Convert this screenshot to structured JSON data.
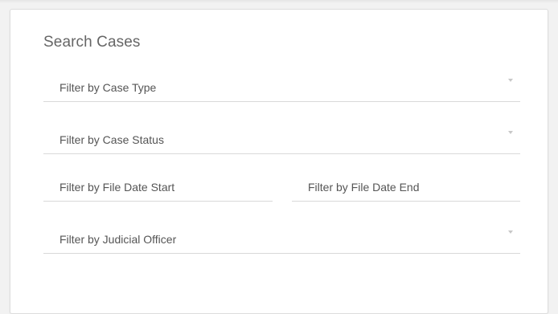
{
  "search_form": {
    "title": "Search Cases",
    "fields": {
      "case_type": {
        "placeholder": "Filter by Case Type",
        "control": "select",
        "icon": "caret-down-icon"
      },
      "case_status": {
        "placeholder": "Filter by Case Status",
        "control": "select",
        "icon": "caret-down-icon"
      },
      "file_date_start": {
        "placeholder": "Filter by File Date Start",
        "control": "date-input"
      },
      "file_date_end": {
        "placeholder": "Filter by File Date End",
        "control": "date-input"
      },
      "judicial_officer": {
        "placeholder": "Filter by Judicial Officer",
        "control": "select",
        "icon": "caret-down-icon"
      }
    }
  },
  "colors": {
    "background": "#f2f2f2",
    "card": "#ffffff",
    "title_text": "#666666",
    "field_text": "#555555",
    "underline": "#d9d9d9",
    "caret": "#c8c8c8"
  }
}
